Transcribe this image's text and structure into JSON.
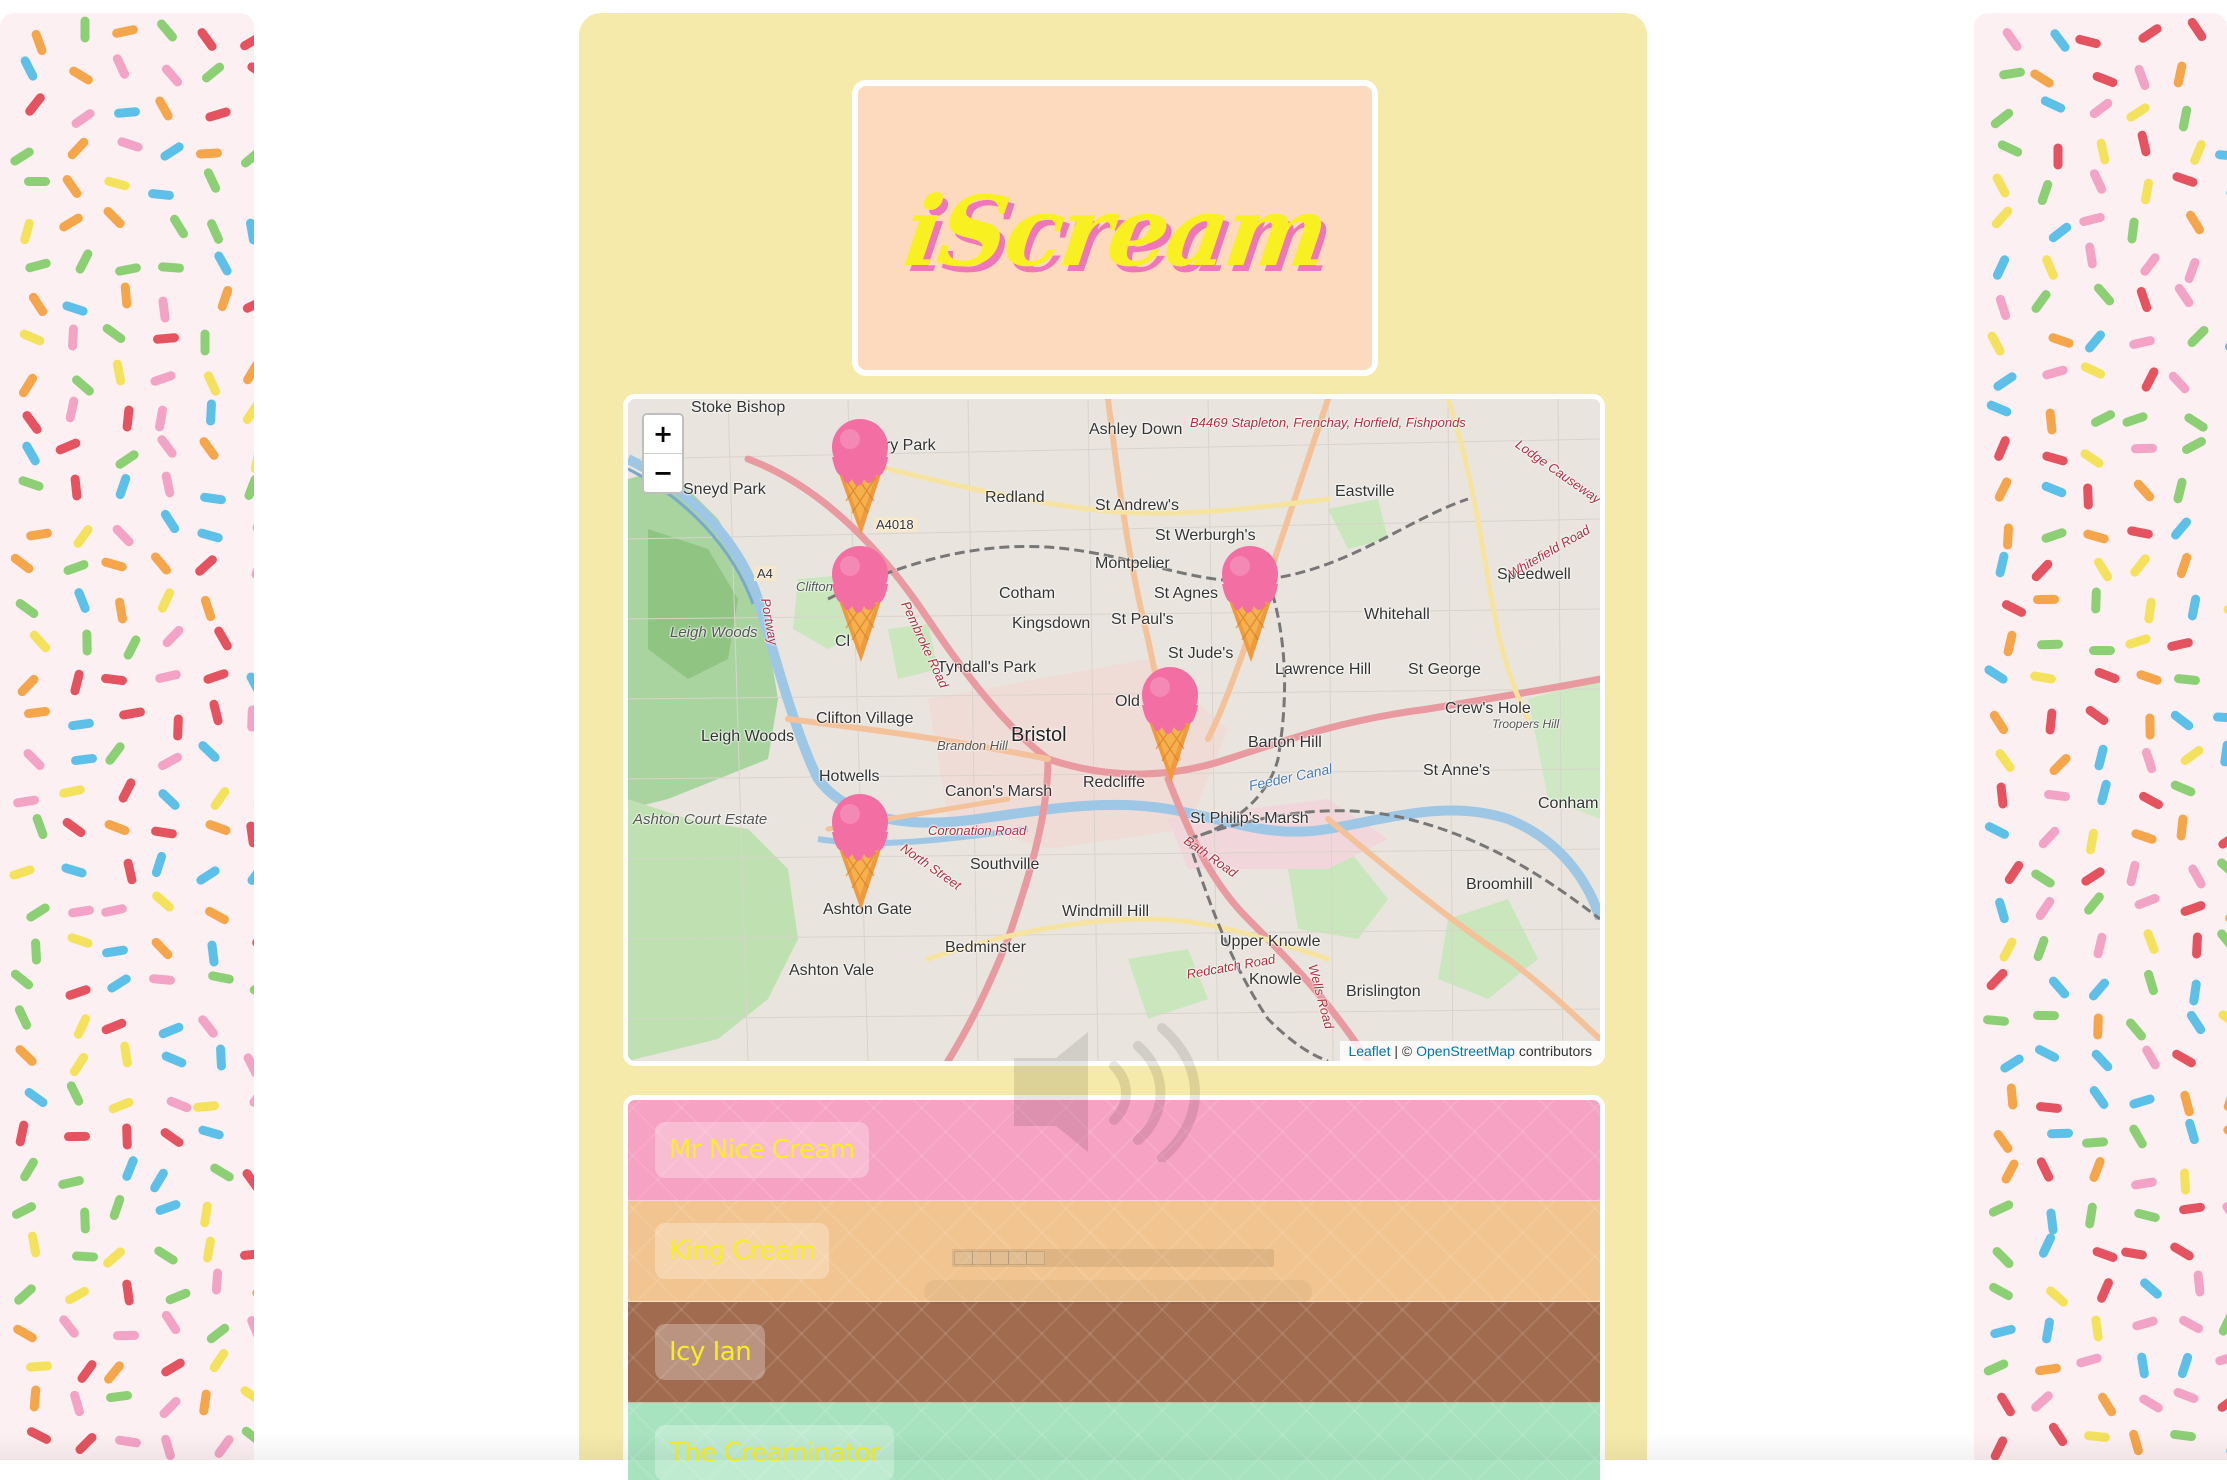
{
  "logo": {
    "text": "iScream"
  },
  "map": {
    "zoom_in_label": "+",
    "zoom_out_label": "−",
    "attribution": {
      "leaflet": "Leaflet",
      "separator": " | © ",
      "osm": "OpenStreetMap",
      "suffix": " contributors"
    },
    "labels": [
      "Stoke Bishop",
      "ury Park",
      "Ashley Down",
      "B4469 Stapleton, Frenchay, Horfield, Fishponds",
      "Sneyd Park",
      "Redland",
      "St Andrew's",
      "Eastville",
      "A4018",
      "St Werburgh's",
      "A4",
      "Clifton Down",
      "Montpelier",
      "Speedwell",
      "Cotham",
      "St Agnes",
      "Whitehall",
      "Leigh Woods",
      "Kingsdown",
      "St Paul's",
      "Cl n",
      "St Jude's",
      "Lawrence Hill",
      "St George",
      "Tyndall's Park",
      "Old",
      "Crew's Hole",
      "Troopers Hill",
      "Clifton Village",
      "Bristol",
      "Brandon Hill",
      "Leigh Woods",
      "Barton Hill",
      "St Anne's",
      "Hotwells",
      "Redcliffe",
      "Canon's Marsh",
      "Conham",
      "Ashton Court Estate",
      "St Philip's Marsh",
      "Coronation Road",
      "Southville",
      "North Street",
      "Broomhill",
      "Ashton Gate",
      "Windmill Hill",
      "Bedminster",
      "Upper Knowle",
      "Ashton Vale",
      "Redcatch Road",
      "Knowle",
      "Brislington",
      "Bath Road",
      "Feeder Canal",
      "Portway",
      "Pembroke Road",
      "Whitefield Road",
      "Lodge Causeway",
      "Wells Road"
    ]
  },
  "vans": [
    {
      "name": "Mr Nice Cream",
      "color": "#f6a2c3"
    },
    {
      "name": "King Cream",
      "color": "#f2c48f"
    },
    {
      "name": "Icy Ian",
      "color": "#a06b4f"
    },
    {
      "name": "The Creaminator",
      "color": "#a7e3bf"
    }
  ],
  "marker_icon": "ice-cream-cone-icon",
  "colors": {
    "card": "#f5eaa9",
    "logo_bg": "#fdd9bd",
    "logo_text": "#f8f021",
    "logo_shadow": "#ef76b8",
    "van_text": "#f8ef23"
  }
}
